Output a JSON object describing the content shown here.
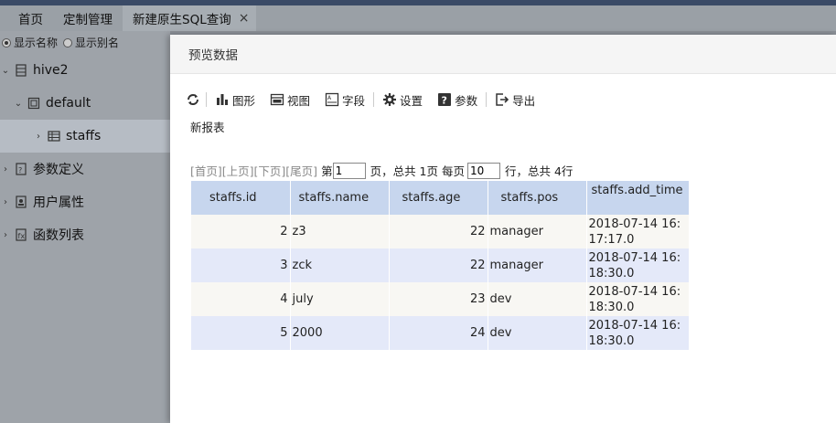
{
  "tabs": [
    {
      "label": "首页"
    },
    {
      "label": "定制管理"
    },
    {
      "label": "新建原生SQL查询",
      "close": "×"
    }
  ],
  "sidebar": {
    "radio_name": "显示名称",
    "radio_alias": "显示别名",
    "tree": {
      "db": "hive2",
      "schema": "default",
      "table": "staffs",
      "params": "参数定义",
      "user_attrs": "用户属性",
      "functions": "函数列表"
    }
  },
  "dialog": {
    "title": "预览数据",
    "toolbar": {
      "chart": "图形",
      "view": "视图",
      "fields": "字段",
      "settings": "设置",
      "params": "参数",
      "export": "导出"
    },
    "report_title": "新报表",
    "pager": {
      "first": "[首页]",
      "prev": "[上页]",
      "next": "[下页]",
      "last": "[尾页]",
      "page_prefix": "第",
      "page_value": "1",
      "page_suffix": "页，总共 1页 每页",
      "size_value": "10",
      "size_suffix": "行，总共 4行"
    },
    "table": {
      "columns": [
        "staffs.id",
        "staffs.name",
        "staffs.age",
        "staffs.pos",
        "staffs.add_time"
      ],
      "rows": [
        [
          "2",
          "z3",
          "22",
          "manager",
          "2018-07-14 16:17:17.0"
        ],
        [
          "3",
          "zck",
          "22",
          "manager",
          "2018-07-14 16:18:30.0"
        ],
        [
          "4",
          "july",
          "23",
          "dev",
          "2018-07-14 16:18:30.0"
        ],
        [
          "5",
          "2000",
          "24",
          "dev",
          "2018-07-14 16:18:30.0"
        ]
      ]
    }
  }
}
